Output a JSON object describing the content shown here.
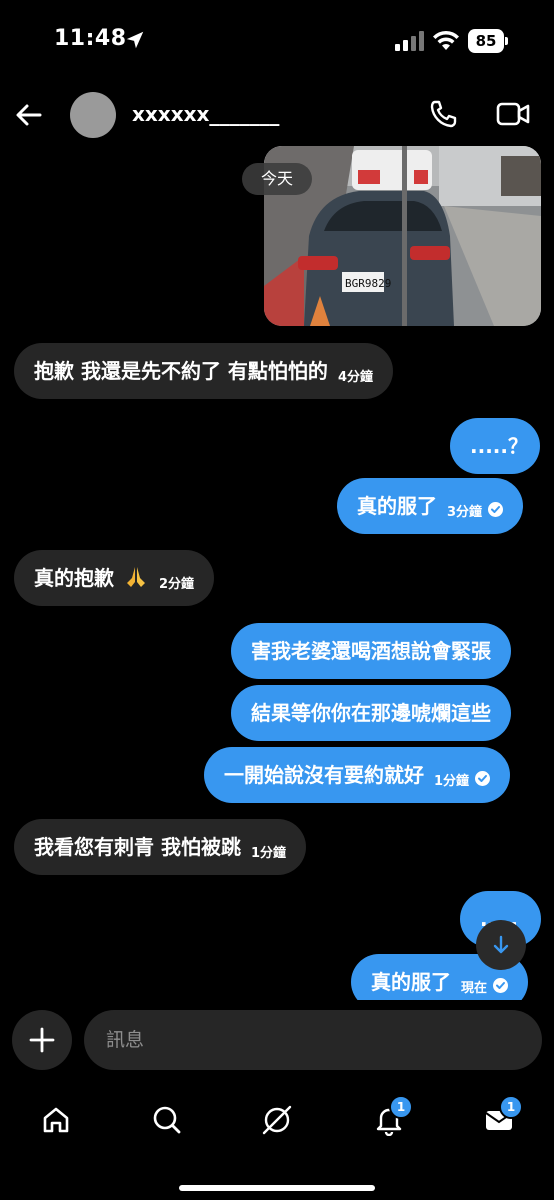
{
  "status_bar": {
    "time": "11:48",
    "battery": "85"
  },
  "header": {
    "contact_name": "xxxxxx_______"
  },
  "photo_message": {
    "date_label": "今天"
  },
  "messages": [
    {
      "sender": "them",
      "text": "抱歉 我還是先不約了 有點怕怕的",
      "time": "4分鐘"
    },
    {
      "sender": "me",
      "text": ".....？"
    },
    {
      "sender": "me",
      "text": "真的服了",
      "time": "3分鐘",
      "seen": true
    },
    {
      "sender": "them",
      "text": "真的抱歉",
      "emoji": "folded-hands-emoji",
      "time": "2分鐘"
    },
    {
      "sender": "me",
      "text": "害我老婆還喝酒想說會緊張"
    },
    {
      "sender": "me",
      "text": "結果等你你在那邊唬爛這些"
    },
    {
      "sender": "me",
      "text": "一開始說沒有要約就好",
      "time": "1分鐘",
      "seen": true
    },
    {
      "sender": "them",
      "text": "我看您有刺青 我怕被跳",
      "time": "1分鐘"
    },
    {
      "sender": "me",
      "text": "....."
    },
    {
      "sender": "me",
      "text": "真的服了",
      "time": "現在",
      "seen": true
    }
  ],
  "composer": {
    "placeholder": "訊息"
  },
  "bottom_nav": {
    "items": [
      {
        "name": "home",
        "icon": "home-icon"
      },
      {
        "name": "search",
        "icon": "search-icon"
      },
      {
        "name": "explore",
        "icon": "explore-icon"
      },
      {
        "name": "notifications",
        "icon": "bell-icon",
        "badge": "1"
      },
      {
        "name": "messages",
        "icon": "inbox-icon",
        "badge": "1"
      }
    ]
  },
  "colors": {
    "outgoing_bubble": "#3897f0",
    "incoming_bubble": "#262626",
    "background": "#000000"
  }
}
